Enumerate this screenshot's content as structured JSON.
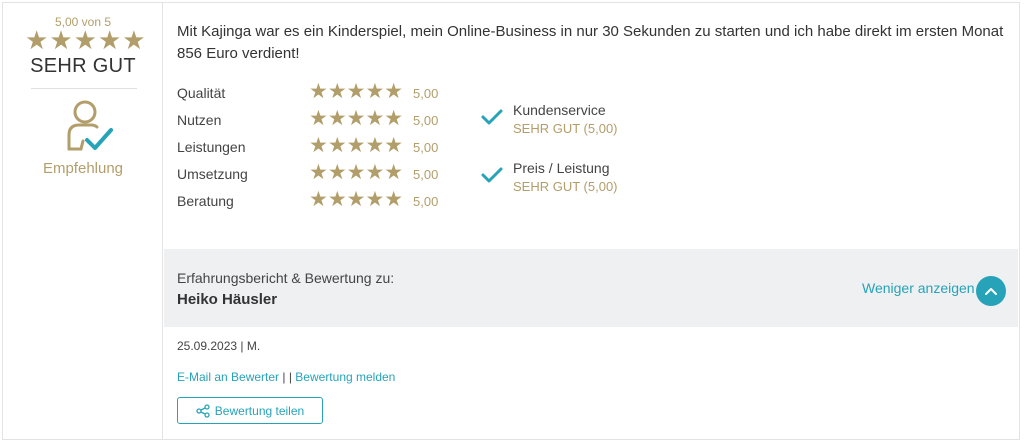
{
  "summary": {
    "score_text": "5,00 von 5",
    "stars": "★★★★★",
    "verdict": "SEHR GUT",
    "recommendation_label": "Empfehlung"
  },
  "review": {
    "text": "Mit Kajinga war es ein Kinderspiel, mein Online-Business in nur 30 Sekunden zu starten und ich habe direkt im ersten Monat 856 Euro verdient!"
  },
  "ratings": [
    {
      "label": "Qualität",
      "stars": "★★★★★",
      "value": "5,00"
    },
    {
      "label": "Nutzen",
      "stars": "★★★★★",
      "value": "5,00"
    },
    {
      "label": "Leistungen",
      "stars": "★★★★★",
      "value": "5,00"
    },
    {
      "label": "Umsetzung",
      "stars": "★★★★★",
      "value": "5,00"
    },
    {
      "label": "Beratung",
      "stars": "★★★★★",
      "value": "5,00"
    }
  ],
  "extras": [
    {
      "title": "Kundenservice",
      "value": "SEHR GUT (5,00)"
    },
    {
      "title": "Preis / Leistung",
      "value": "SEHR GUT (5,00)"
    }
  ],
  "report": {
    "subtitle": "Erfahrungsbericht & Bewertung zu:",
    "name": "Heiko Häusler",
    "toggle_label": "Weniger anzeigen"
  },
  "footer": {
    "meta": "25.09.2023 | M.",
    "email_link": "E-Mail an Bewerter",
    "separator": " | | ",
    "report_link": "Bewertung melden",
    "share_label": "Bewertung teilen"
  },
  "colors": {
    "gold": "#b29e6a",
    "teal": "#26a3b8",
    "grey_bg": "#eef0f2"
  },
  "icons": {
    "recommendation": "person-check-icon",
    "check": "checkmark-icon",
    "chevron": "chevron-up-icon",
    "share": "share-icon"
  }
}
